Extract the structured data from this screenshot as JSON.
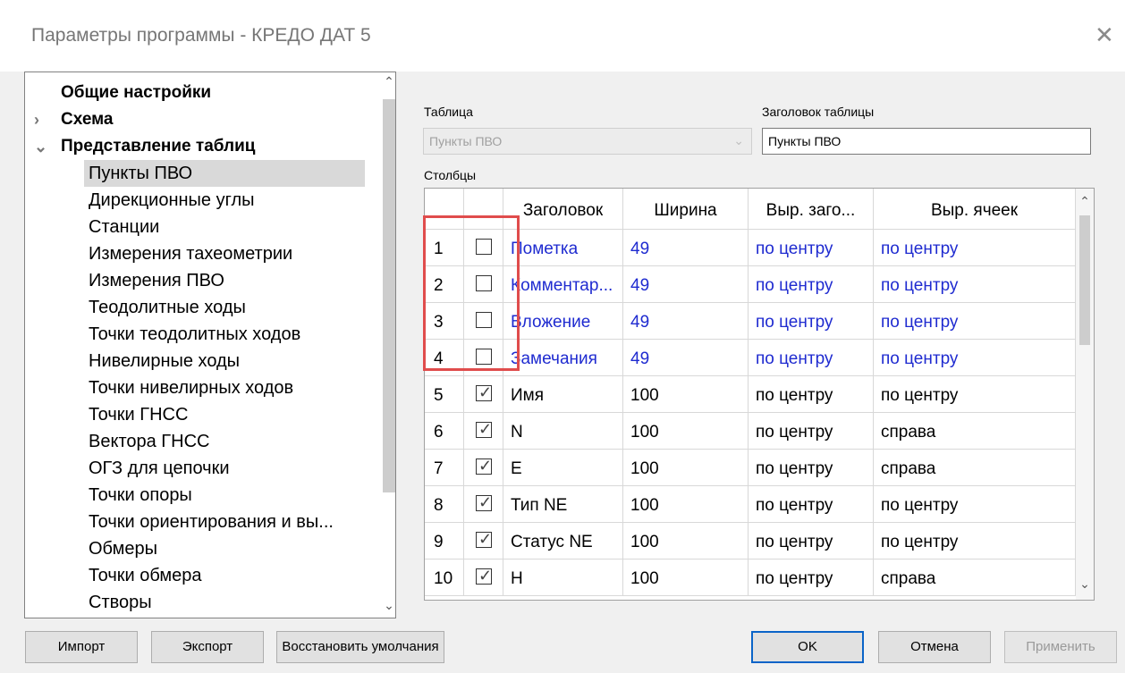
{
  "window": {
    "title": "Параметры программы - КРЕДО ДАТ 5"
  },
  "tree": {
    "items": [
      {
        "label": "Общие настройки",
        "level": 0,
        "bold": true,
        "arrow": ""
      },
      {
        "label": "Схема",
        "level": 0,
        "bold": true,
        "arrow": ">"
      },
      {
        "label": "Представление таблиц",
        "level": 0,
        "bold": true,
        "arrow": "v"
      },
      {
        "label": "Пункты ПВО",
        "level": 1,
        "selected": true
      },
      {
        "label": "Дирекционные углы",
        "level": 1
      },
      {
        "label": "Станции",
        "level": 1
      },
      {
        "label": "Измерения тахеометрии",
        "level": 1
      },
      {
        "label": "Измерения ПВО",
        "level": 1
      },
      {
        "label": "Теодолитные ходы",
        "level": 1
      },
      {
        "label": "Точки теодолитных ходов",
        "level": 1
      },
      {
        "label": "Нивелирные ходы",
        "level": 1
      },
      {
        "label": "Точки нивелирных ходов",
        "level": 1
      },
      {
        "label": "Точки ГНСС",
        "level": 1
      },
      {
        "label": "Вектора ГНСС",
        "level": 1
      },
      {
        "label": "ОГЗ для цепочки",
        "level": 1
      },
      {
        "label": "Точки опоры",
        "level": 1
      },
      {
        "label": "Точки ориентирования и вы...",
        "level": 1
      },
      {
        "label": "Обмеры",
        "level": 1
      },
      {
        "label": "Точки обмера",
        "level": 1
      },
      {
        "label": "Створы",
        "level": 1
      }
    ]
  },
  "table_selector": {
    "label": "Таблица",
    "value": "Пункты ПВО"
  },
  "table_title": {
    "label": "Заголовок таблицы",
    "value": "Пункты ПВО"
  },
  "columns_label": "Столбцы",
  "grid": {
    "headers": [
      "Заголовок",
      "Ширина",
      "Выр. заго...",
      "Выр. ячеек"
    ],
    "rows": [
      {
        "n": "1",
        "checked": false,
        "title": "Пометка",
        "width": "49",
        "hdr_align": "по центру",
        "cell_align": "по центру",
        "highlight": true
      },
      {
        "n": "2",
        "checked": false,
        "title": "Комментар...",
        "width": "49",
        "hdr_align": "по центру",
        "cell_align": "по центру",
        "highlight": true
      },
      {
        "n": "3",
        "checked": false,
        "title": "Вложение",
        "width": "49",
        "hdr_align": "по центру",
        "cell_align": "по центру",
        "highlight": true
      },
      {
        "n": "4",
        "checked": false,
        "title": "Замечания",
        "width": "49",
        "hdr_align": "по центру",
        "cell_align": "по центру",
        "highlight": true
      },
      {
        "n": "5",
        "checked": true,
        "title": "Имя",
        "width": "100",
        "hdr_align": "по центру",
        "cell_align": "по центру",
        "highlight": false
      },
      {
        "n": "6",
        "checked": true,
        "title": "N",
        "width": "100",
        "hdr_align": "по центру",
        "cell_align": "справа",
        "highlight": false
      },
      {
        "n": "7",
        "checked": true,
        "title": "E",
        "width": "100",
        "hdr_align": "по центру",
        "cell_align": "справа",
        "highlight": false
      },
      {
        "n": "8",
        "checked": true,
        "title": "Тип NE",
        "width": "100",
        "hdr_align": "по центру",
        "cell_align": "по центру",
        "highlight": false
      },
      {
        "n": "9",
        "checked": true,
        "title": "Статус NE",
        "width": "100",
        "hdr_align": "по центру",
        "cell_align": "по центру",
        "highlight": false
      },
      {
        "n": "10",
        "checked": true,
        "title": "H",
        "width": "100",
        "hdr_align": "по центру",
        "cell_align": "справа",
        "highlight": false
      }
    ]
  },
  "buttons": {
    "import": "Импорт",
    "export": "Экспорт",
    "restore": "Восстановить умолчания",
    "ok": "OK",
    "cancel": "Отмена",
    "apply": "Применить"
  },
  "colors": {
    "link_blue": "#1f2bd0",
    "annotation_red": "#e04c4c",
    "ok_border": "#0a64c8"
  }
}
